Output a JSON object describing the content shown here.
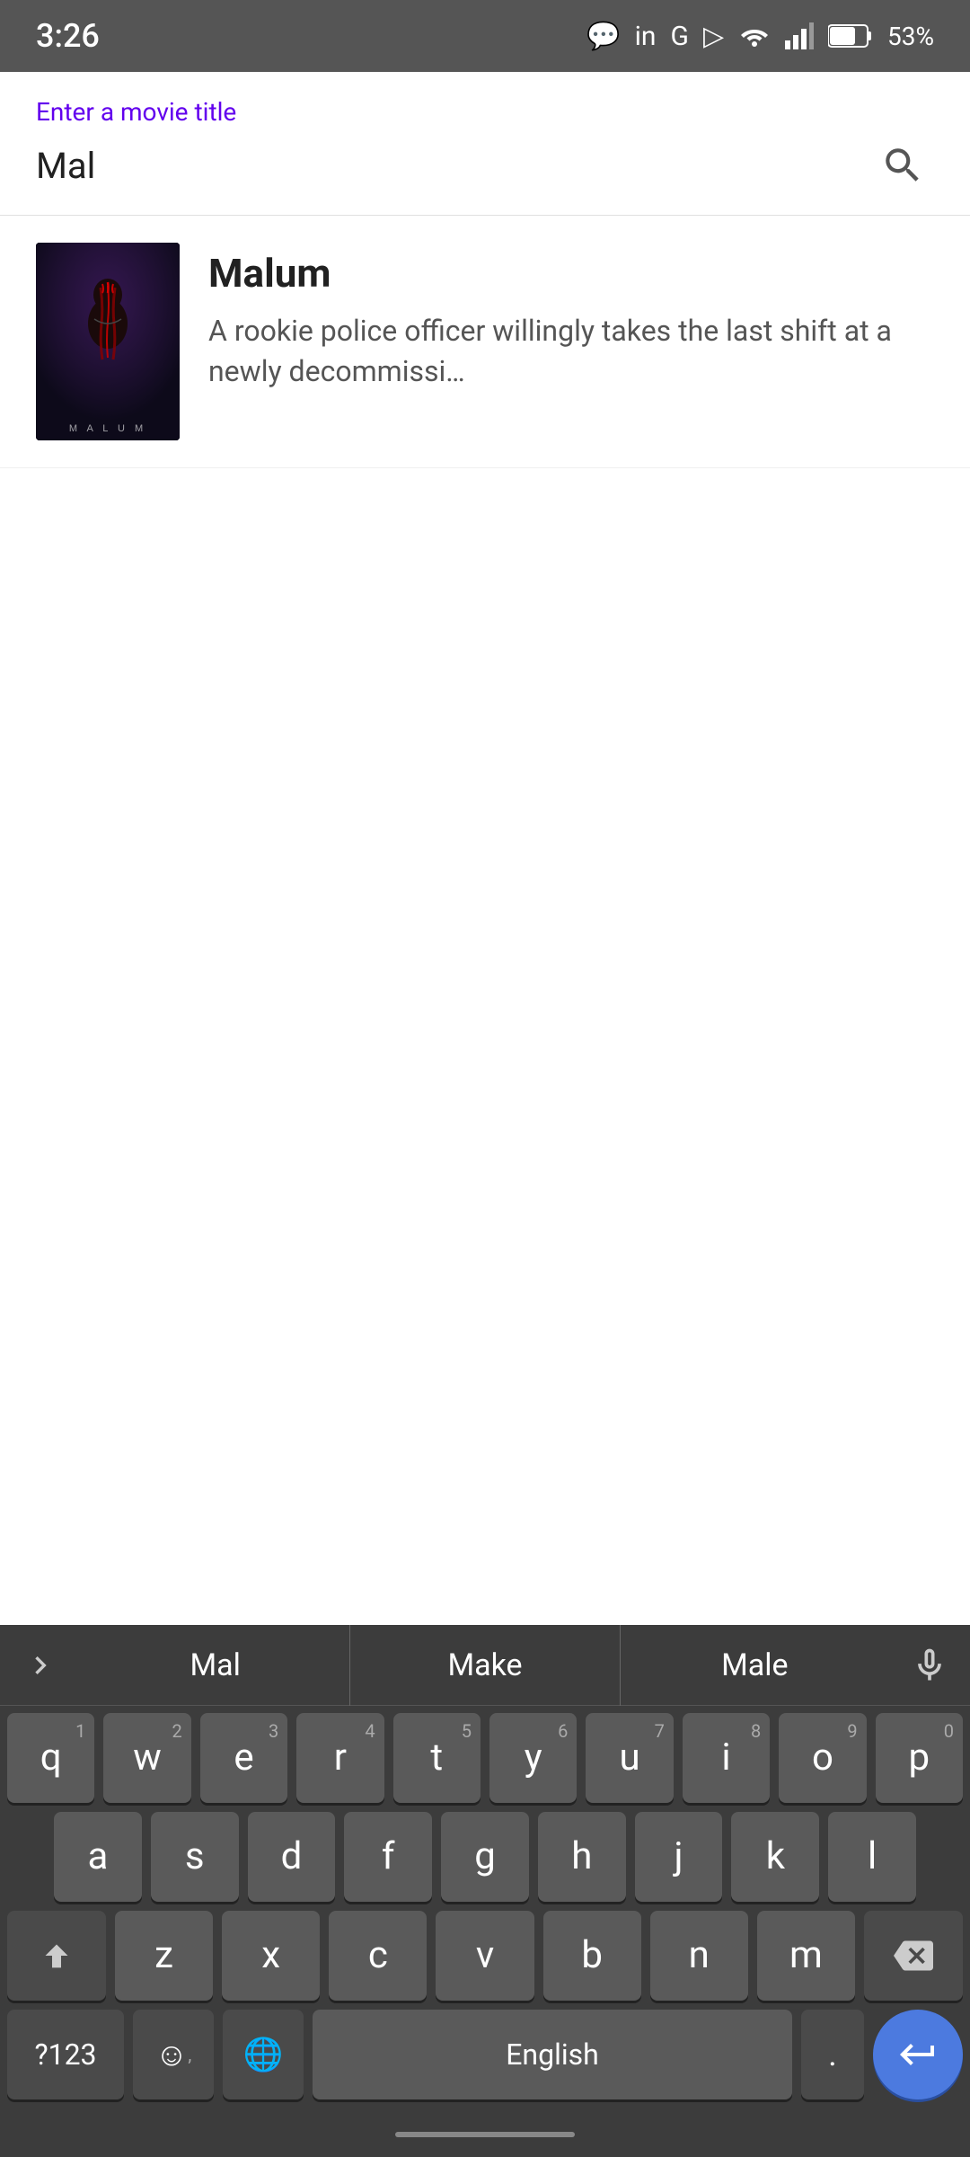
{
  "statusBar": {
    "time": "3:26",
    "battery": "53%"
  },
  "searchArea": {
    "label": "Enter a movie title",
    "value": "Mal"
  },
  "results": [
    {
      "id": 1,
      "title": "Malum",
      "description": "A rookie police officer willingly takes the last shift at a newly decommissi…",
      "posterText": "M A L U M"
    }
  ],
  "keyboard": {
    "suggestions": [
      "Mal",
      "Make",
      "Male"
    ],
    "rows": [
      [
        "q",
        "w",
        "e",
        "r",
        "t",
        "y",
        "u",
        "i",
        "o",
        "p"
      ],
      [
        "a",
        "s",
        "d",
        "f",
        "g",
        "h",
        "j",
        "k",
        "l"
      ],
      [
        "z",
        "x",
        "c",
        "v",
        "b",
        "n",
        "m"
      ]
    ],
    "numbers": [
      "1",
      "2",
      "3",
      "4",
      "5",
      "6",
      "7",
      "8",
      "9",
      "0"
    ],
    "spaceLabel": "English",
    "numSymLabel": "?123",
    "periodLabel": "."
  }
}
